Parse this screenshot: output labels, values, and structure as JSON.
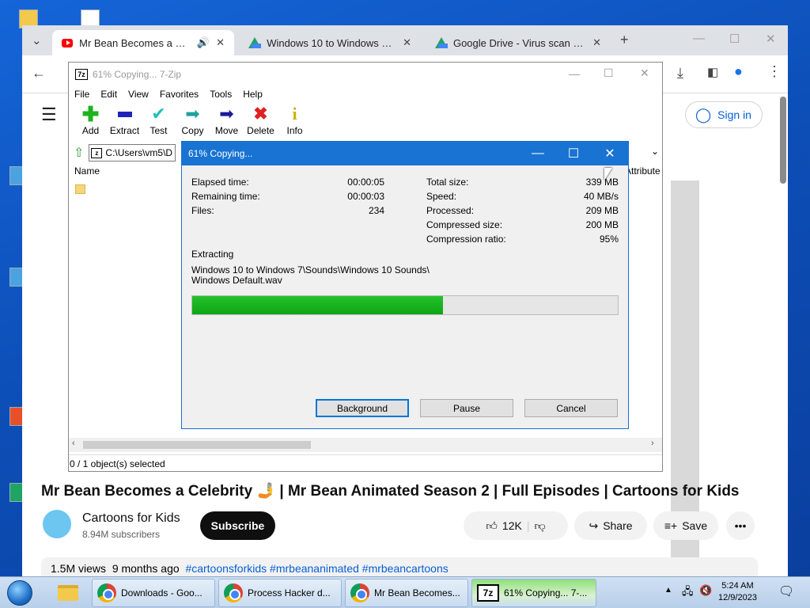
{
  "chrome": {
    "tabs": [
      {
        "title": "Mr Bean Becomes a Celebr",
        "icon": "youtube-icon",
        "has_audio": true
      },
      {
        "title": "Windows 10 to Windows 7.zip",
        "icon": "google-drive-icon"
      },
      {
        "title": "Google Drive - Virus scan warn",
        "icon": "google-drive-icon"
      }
    ],
    "sign_in": "Sign in"
  },
  "youtube": {
    "video_title": "Mr Bean Becomes a Celebrity 🤳 | Mr Bean Animated Season 2 | Full Episodes | Cartoons for Kids",
    "channel_name": "Cartoons for Kids",
    "subscribers": "8.94M subscribers",
    "subscribe_label": "Subscribe",
    "likes": "12K",
    "share_label": "Share",
    "save_label": "Save",
    "views": "1.5M views",
    "age": "9 months ago",
    "tags": "#cartoonsforkids #mrbeananimated #mrbeancartoons"
  },
  "zip_window": {
    "title": "61% Copying... 7-Zip",
    "menu": [
      "File",
      "Edit",
      "View",
      "Favorites",
      "Tools",
      "Help"
    ],
    "tools": [
      {
        "label": "Add",
        "icon": "add-icon",
        "color": "#1db31d"
      },
      {
        "label": "Extract",
        "icon": "extract-icon",
        "color": "#2222bb"
      },
      {
        "label": "Test",
        "icon": "test-icon",
        "color": "#20c0c0"
      },
      {
        "label": "Copy",
        "icon": "copy-icon",
        "color": "#20a0a0"
      },
      {
        "label": "Move",
        "icon": "move-icon",
        "color": "#1a1a99"
      },
      {
        "label": "Delete",
        "icon": "delete-icon",
        "color": "#e02020"
      },
      {
        "label": "Info",
        "icon": "info-icon",
        "color": "#c8b400"
      }
    ],
    "address": "C:\\Users\\vm5\\D",
    "column_name": "Name",
    "column_attributes": "Attribute",
    "status": "0 / 1 object(s) selected"
  },
  "progress_dialog": {
    "title": "61% Copying...",
    "elapsed_label": "Elapsed time:",
    "elapsed_value": "00:00:05",
    "remaining_label": "Remaining time:",
    "remaining_value": "00:00:03",
    "files_label": "Files:",
    "files_value": "234",
    "total_size_label": "Total size:",
    "total_size_value": "339 MB",
    "speed_label": "Speed:",
    "speed_value": "40 MB/s",
    "processed_label": "Processed:",
    "processed_value": "209 MB",
    "compressed_label": "Compressed size:",
    "compressed_value": "200 MB",
    "ratio_label": "Compression ratio:",
    "ratio_value": "95%",
    "operation": "Extracting",
    "current_file_line1": "Windows 10 to Windows 7\\Sounds\\Windows 10 Sounds\\",
    "current_file_line2": "Windows Default.wav",
    "progress_fraction": 0.59,
    "buttons": {
      "background": "Background",
      "pause": "Pause",
      "cancel": "Cancel"
    }
  },
  "taskbar": {
    "items": [
      {
        "label": "Downloads - Goo...",
        "icon": "chrome-icon"
      },
      {
        "label": "Process Hacker d...",
        "icon": "chrome-icon"
      },
      {
        "label": "Mr Bean Becomes...",
        "icon": "chrome-icon"
      },
      {
        "label": "61% Copying... 7-...",
        "icon": "7zip-icon"
      }
    ],
    "time": "5:24 AM",
    "date": "12/9/2023"
  }
}
